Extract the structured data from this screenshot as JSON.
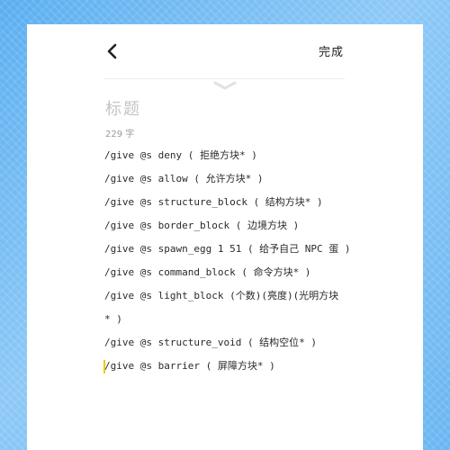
{
  "header": {
    "back_icon": "chevron-left-icon",
    "done_label": "完成",
    "collapse_icon": "chevron-down-icon"
  },
  "note": {
    "title_placeholder": "标题",
    "char_count": "229 字",
    "lines": [
      "/give @s deny ( 拒绝方块* )",
      "/give @s allow ( 允许方块* )",
      "/give @s structure_block ( 结构方块* )",
      "/give @s border_block ( 边境方块 )",
      "/give @s spawn_egg 1 51  ( 给予自己 NPC 蛋 )",
      "/give @s command_block ( 命令方块* )",
      "/give @s light_block (个数)(亮度)(光明方块",
      "* )",
      "/give @s structure_void ( 结构空位* )",
      "/give @s barrier ( 屏障方块* )"
    ]
  },
  "colors": {
    "background": "#6ab6f2",
    "cursor": "#f0c800"
  }
}
